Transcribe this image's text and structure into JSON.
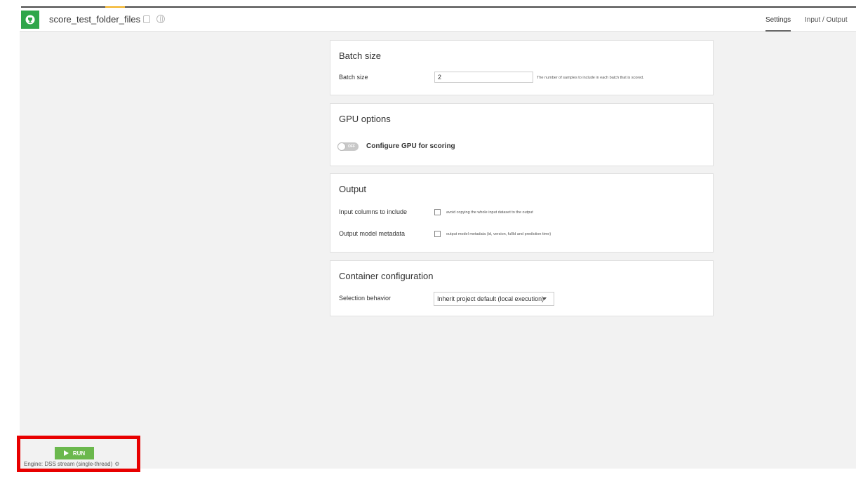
{
  "header": {
    "recipe_name": "score_test_folder_files",
    "icons": {
      "recipe": "trophy-icon",
      "copy": "copy-icon",
      "globe": "globe-icon"
    },
    "tabs": [
      {
        "label": "Settings",
        "active": true
      },
      {
        "label": "Input / Output",
        "active": false
      }
    ]
  },
  "sections": {
    "batch": {
      "title": "Batch size",
      "label": "Batch size",
      "value": "2",
      "help": "The number of samples to include in each batch that is scored."
    },
    "gpu": {
      "title": "GPU options",
      "toggle_state": "OFF",
      "toggle_on": false,
      "label": "Configure GPU for scoring"
    },
    "output": {
      "title": "Output",
      "input_columns_label": "Input columns to include",
      "input_columns_checkbox": "avoid copying the whole input dataset to the output",
      "input_columns_checked": false,
      "metadata_label": "Output model metadata",
      "metadata_checkbox": "output model metadata (id, version, fullId and prediction time)",
      "metadata_checked": false
    },
    "container": {
      "title": "Container configuration",
      "label": "Selection behavior",
      "selected": "Inherit project default (local execution)"
    }
  },
  "footer": {
    "run_label": "RUN",
    "engine_label": "Engine: DSS stream (single-thread)",
    "icons": {
      "run": "play-icon",
      "engine_settings": "gear-icon"
    }
  },
  "colors": {
    "recipe_icon": "#2fa64a",
    "run_button": "#6bb84d",
    "highlight": "#e80000",
    "tab_accent": "#f2b01e"
  }
}
